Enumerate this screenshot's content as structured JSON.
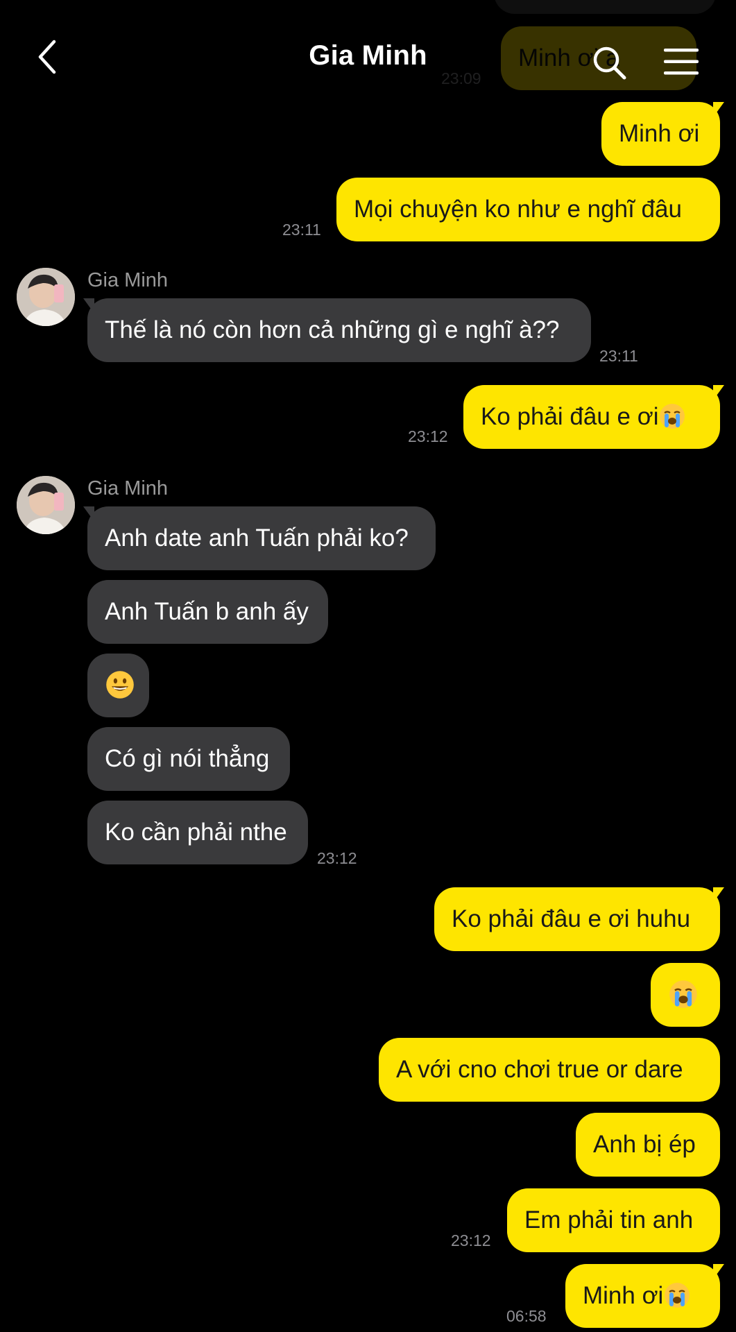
{
  "header": {
    "title": "Gia Minh",
    "back_icon": "chevron-left-icon",
    "search_icon": "search-icon",
    "menu_icon": "hamburger-menu-icon"
  },
  "colors": {
    "background": "#000000",
    "my_bubble": "#FEE500",
    "their_bubble": "#3A3A3C",
    "timestamp": "#8E8E93"
  },
  "messages": {
    "ghost_bubble": "Minh ơi à",
    "ghost_time": "23:09",
    "m1": "Minh ơi",
    "m2": "Mọi chuyện ko như e nghĩ đâu",
    "m2_time": "23:11",
    "sender1": "Gia Minh",
    "t1": "Thế là nó còn hơn cả những gì e nghĩ à??",
    "t1_time": "23:11",
    "m3": "Ko phải đâu e ơi",
    "m3_time": "23:12",
    "sender2": "Gia Minh",
    "t2": "Anh date anh Tuấn phải ko?",
    "t3": "Anh Tuấn b anh ấy",
    "t4_emoji": "grinning-face-emoji",
    "t5": "Có gì nói thẳng",
    "t6": "Ko cần phải nthe",
    "t6_time": "23:12",
    "m4": "Ko phải đâu e ơi huhu",
    "m5_emoji": "loudly-crying-face-emoji",
    "m6": "A với cno chơi true or dare",
    "m7": "Anh bị ép",
    "m8": "Em phải tin anh",
    "m8_time": "23:12",
    "m9": "Minh ơi",
    "m9_time": "06:58"
  }
}
